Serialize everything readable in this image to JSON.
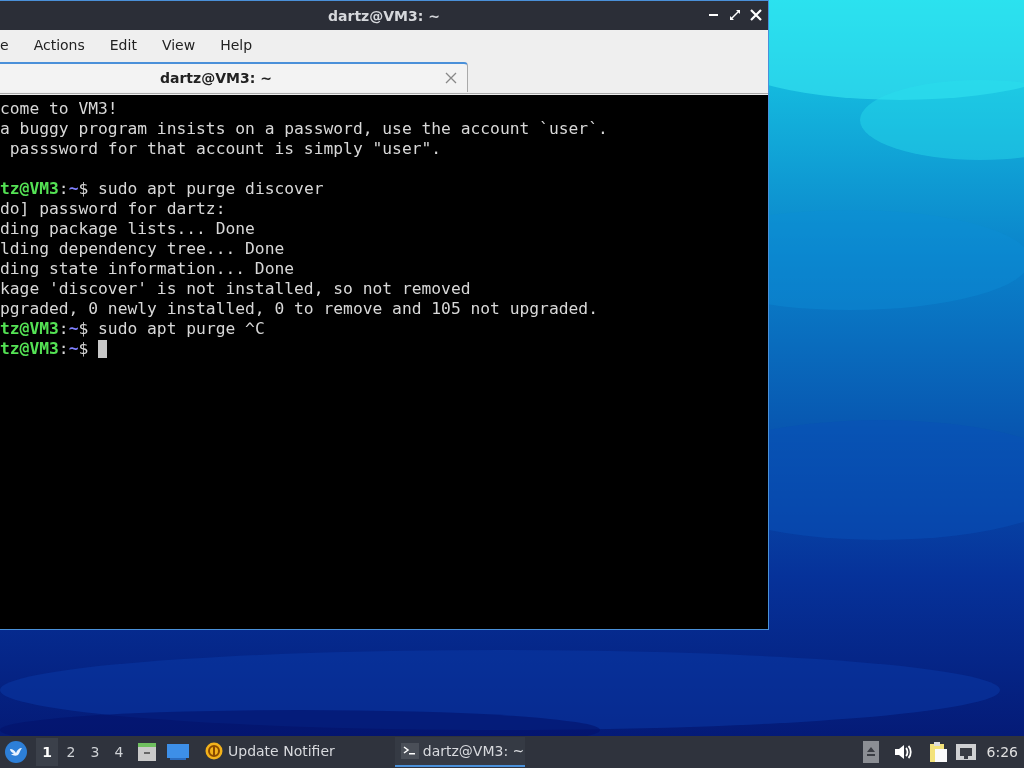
{
  "window": {
    "title": "dartz@VM3: ~"
  },
  "menu": [
    "e",
    "Actions",
    "Edit",
    "View",
    "Help"
  ],
  "tabs": [
    {
      "label": "dartz@VM3: ~",
      "selected": true
    }
  ],
  "terminal": {
    "lines": [
      {
        "kind": "text",
        "text": "come to VM3!"
      },
      {
        "kind": "text",
        "text": "a buggy program insists on a password, use the account `user`."
      },
      {
        "kind": "text",
        "text": " passsword for that account is simply \"user\"."
      },
      {
        "kind": "blank"
      },
      {
        "kind": "prompt",
        "user": "tz@VM3",
        "colon": ":",
        "path": "~",
        "command": "$ sudo apt purge discover"
      },
      {
        "kind": "text",
        "text": "do] password for dartz:"
      },
      {
        "kind": "text",
        "text": "ding package lists... Done"
      },
      {
        "kind": "text",
        "text": "lding dependency tree... Done"
      },
      {
        "kind": "text",
        "text": "ding state information... Done"
      },
      {
        "kind": "text",
        "text": "kage 'discover' is not installed, so not removed"
      },
      {
        "kind": "text",
        "text": "pgraded, 0 newly installed, 0 to remove and 105 not upgraded."
      },
      {
        "kind": "prompt",
        "user": "tz@VM3",
        "colon": ":",
        "path": "~",
        "command": "$ sudo apt purge ^C"
      },
      {
        "kind": "prompt",
        "user": "tz@VM3",
        "colon": ":",
        "path": "~",
        "command": "$",
        "cursor": true
      }
    ]
  },
  "taskbar": {
    "workspaces": [
      {
        "label": "1",
        "selected": true
      },
      {
        "label": "2",
        "selected": false
      },
      {
        "label": "3",
        "selected": false
      },
      {
        "label": "4",
        "selected": false
      }
    ],
    "tasks": [
      {
        "kind": "notifier",
        "label": "Update Notifier",
        "selected": false
      },
      {
        "kind": "terminal",
        "label": "dartz@VM3: ~",
        "selected": true
      }
    ],
    "clock": "6:26"
  }
}
